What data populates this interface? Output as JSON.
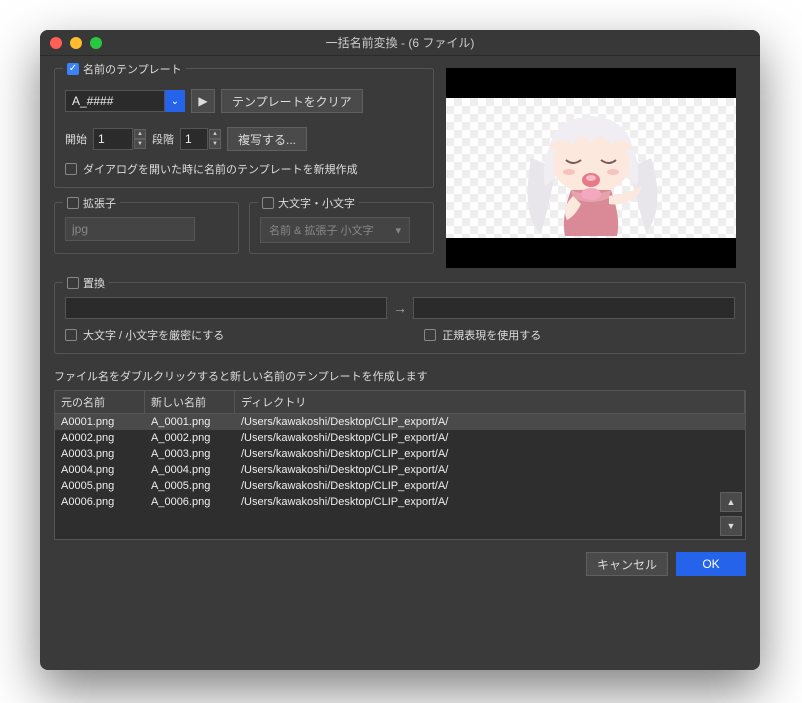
{
  "window": {
    "title": "一括名前変換 - (6 ファイル)"
  },
  "template": {
    "checkbox_label": "名前のテンプレート",
    "pattern": "A_####",
    "play_icon": "▶",
    "clear_btn": "テンプレートをクリア",
    "start_label": "開始",
    "start_value": "1",
    "step_label": "段階",
    "step_value": "1",
    "copy_btn": "複写する...",
    "new_on_open_label": "ダイアログを開いた時に名前のテンプレートを新規作成"
  },
  "ext": {
    "label": "拡張子",
    "value": "jpg"
  },
  "case": {
    "label": "大文字・小文字",
    "value": "名前 & 拡張子 小文字",
    "caret": "▾"
  },
  "replace": {
    "label": "置換",
    "strict_label": "大文字 / 小文字を厳密にする",
    "regex_label": "正規表現を使用する"
  },
  "hint": "ファイル名をダブルクリックすると新しい名前のテンプレートを作成します",
  "table": {
    "headers": {
      "old": "元の名前",
      "new": "新しい名前",
      "dir": "ディレクトリ"
    },
    "rows": [
      {
        "old": "A0001.png",
        "new": "A_0001.png",
        "dir": "/Users/kawakoshi/Desktop/CLIP_export/A/"
      },
      {
        "old": "A0002.png",
        "new": "A_0002.png",
        "dir": "/Users/kawakoshi/Desktop/CLIP_export/A/"
      },
      {
        "old": "A0003.png",
        "new": "A_0003.png",
        "dir": "/Users/kawakoshi/Desktop/CLIP_export/A/"
      },
      {
        "old": "A0004.png",
        "new": "A_0004.png",
        "dir": "/Users/kawakoshi/Desktop/CLIP_export/A/"
      },
      {
        "old": "A0005.png",
        "new": "A_0005.png",
        "dir": "/Users/kawakoshi/Desktop/CLIP_export/A/"
      },
      {
        "old": "A0006.png",
        "new": "A_0006.png",
        "dir": "/Users/kawakoshi/Desktop/CLIP_export/A/"
      }
    ]
  },
  "buttons": {
    "cancel": "キャンセル",
    "ok": "OK"
  }
}
